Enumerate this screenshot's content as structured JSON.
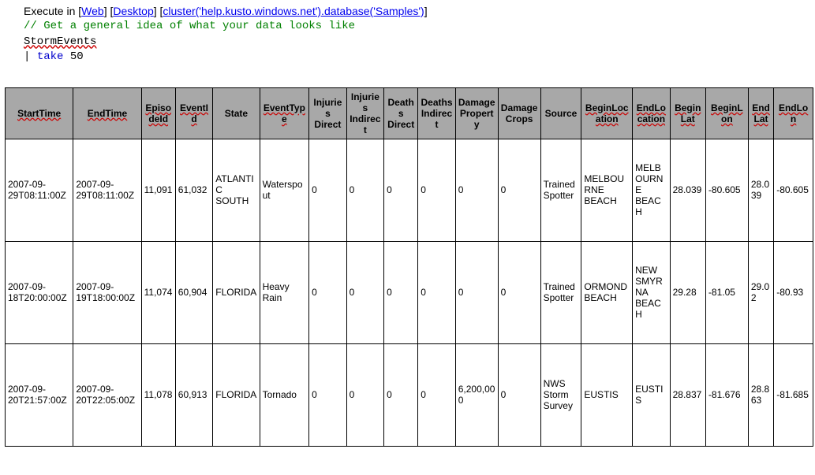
{
  "topbar": {
    "executeIn": "Execute in",
    "webLabel": "Web",
    "desktopLabel": "Desktop",
    "clusterLabel": "cluster('help.kusto.windows.net').database('Samples')"
  },
  "code": {
    "comment": "// Get a general idea of what your data looks like",
    "line1": "StormEvents",
    "line2pipe": "| ",
    "line2kw": "take",
    "line2rest": " 50"
  },
  "headers": {
    "StartTime": "StartTime",
    "EndTime": "EndTime",
    "EpisodeId": "EpisodeId",
    "EventId": "EventId",
    "State": "State",
    "EventType": "EventType",
    "InjuriesDirect": "Injuries Direct",
    "InjuriesIndirect": "Injuries Indirect",
    "DeathsDirect": "Deaths Direct",
    "DeathsIndirect": "Deaths Indirect",
    "DamageProperty": "Damage Property",
    "DamageCrops": "Damage Crops",
    "Source": "Source",
    "BeginLocation": "BeginLocation",
    "EndLocation": "EndLocation",
    "BeginLat": "BeginLat",
    "BeginLon": "BeginLon",
    "EndLat": "EndLat",
    "EndLon": "EndLon"
  },
  "rows": [
    {
      "StartTime": "2007-09-29T08:11:00Z",
      "EndTime": "2007-09-29T08:11:00Z",
      "EpisodeId": "11,091",
      "EventId": "61,032",
      "State": "ATLANTIC SOUTH",
      "EventType": "Waterspout",
      "InjuriesDirect": "0",
      "InjuriesIndirect": "0",
      "DeathsDirect": "0",
      "DeathsIndirect": "0",
      "DamageProperty": "0",
      "DamageCrops": "0",
      "Source": "Trained Spotter",
      "BeginLocation": "MELBOURNE BEACH",
      "EndLocation": "MELBOURNE BEACH",
      "BeginLat": "28.039",
      "BeginLon": "-80.605",
      "EndLat": "28.039",
      "EndLon": "-80.605"
    },
    {
      "StartTime": "2007-09-18T20:00:00Z",
      "EndTime": "2007-09-19T18:00:00Z",
      "EpisodeId": "11,074",
      "EventId": "60,904",
      "State": "FLORIDA",
      "EventType": "Heavy Rain",
      "InjuriesDirect": "0",
      "InjuriesIndirect": "0",
      "DeathsDirect": "0",
      "DeathsIndirect": "0",
      "DamageProperty": "0",
      "DamageCrops": "0",
      "Source": "Trained Spotter",
      "BeginLocation": "ORMOND BEACH",
      "EndLocation": "NEW SMYRNA BEACH",
      "BeginLat": "29.28",
      "BeginLon": "-81.05",
      "EndLat": "29.02",
      "EndLon": "-80.93"
    },
    {
      "StartTime": "2007-09-20T21:57:00Z",
      "EndTime": "2007-09-20T22:05:00Z",
      "EpisodeId": "11,078",
      "EventId": "60,913",
      "State": "FLORIDA",
      "EventType": "Tornado",
      "InjuriesDirect": "0",
      "InjuriesIndirect": "0",
      "DeathsDirect": "0",
      "DeathsIndirect": "0",
      "DamageProperty": "6,200,000",
      "DamageCrops": "0",
      "Source": "NWS Storm Survey",
      "BeginLocation": "EUSTIS",
      "EndLocation": "EUSTIS",
      "BeginLat": "28.837",
      "BeginLon": "-81.676",
      "EndLat": "28.863",
      "EndLon": "-81.685"
    }
  ]
}
